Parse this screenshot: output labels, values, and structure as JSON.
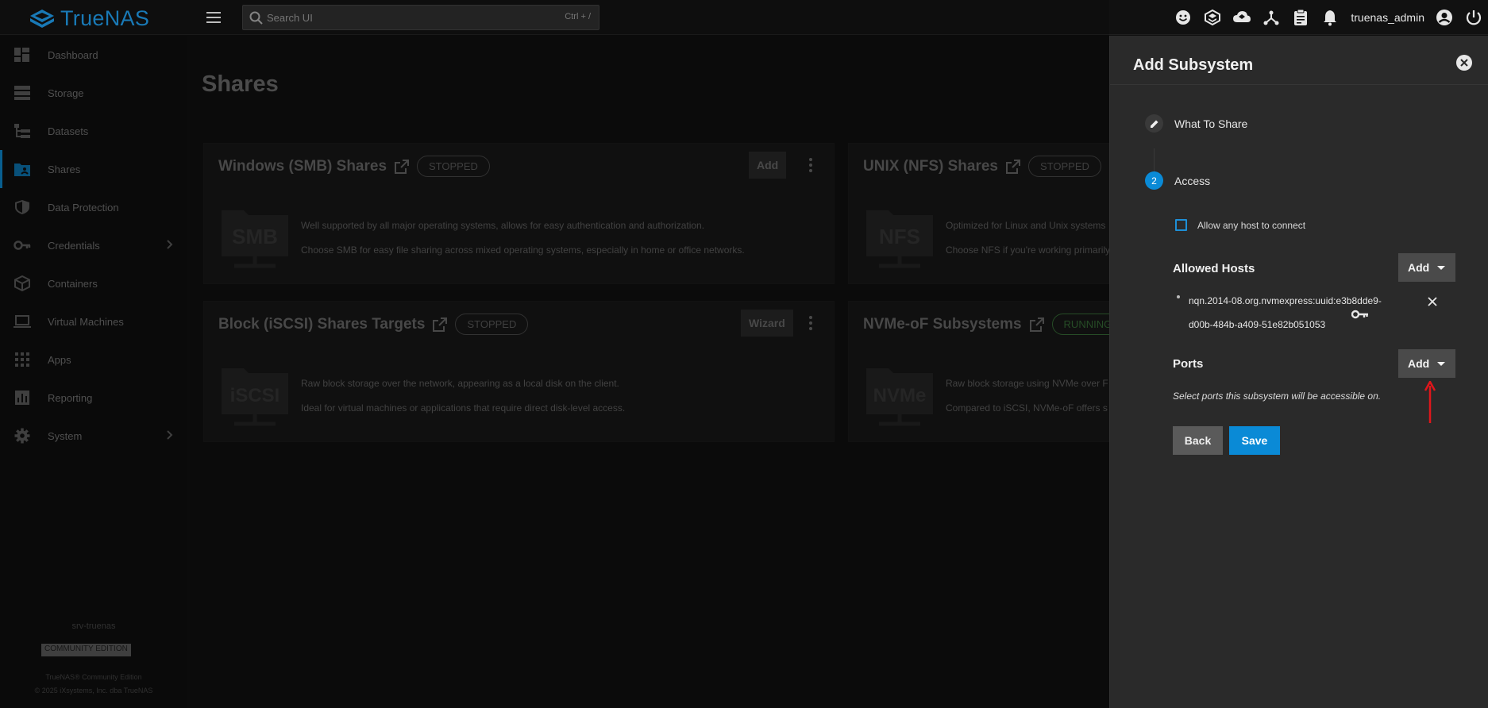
{
  "app": {
    "name": "TrueNAS",
    "search_placeholder": "Search UI",
    "search_shortcut": "Ctrl + /",
    "username": "truenas_admin"
  },
  "top_icons": [
    "smiley-icon",
    "truecommand-icon",
    "cloud-icon",
    "network-fork-icon",
    "clipboard-icon",
    "bell-icon",
    "account-circle-icon",
    "power-icon"
  ],
  "sidebar": {
    "items": [
      {
        "label": "Dashboard",
        "icon": "dashboard-icon"
      },
      {
        "label": "Storage",
        "icon": "storage-icon"
      },
      {
        "label": "Datasets",
        "icon": "datasets-icon"
      },
      {
        "label": "Shares",
        "icon": "shares-icon",
        "active": true
      },
      {
        "label": "Data Protection",
        "icon": "shield-icon"
      },
      {
        "label": "Credentials",
        "icon": "key-icon",
        "has_children": true
      },
      {
        "label": "Containers",
        "icon": "cube-icon"
      },
      {
        "label": "Virtual Machines",
        "icon": "laptop-icon"
      },
      {
        "label": "Apps",
        "icon": "apps-grid-icon"
      },
      {
        "label": "Reporting",
        "icon": "chart-icon"
      },
      {
        "label": "System",
        "icon": "gear-icon",
        "has_children": true
      }
    ],
    "hostname": "srv-truenas",
    "edition": "COMMUNITY EDITION",
    "copyright_line1": "TrueNAS® Community Edition",
    "copyright_line2": "© 2025 iXsystems, Inc. dba TrueNAS"
  },
  "main": {
    "page_title": "Shares",
    "cards": [
      {
        "title": "Windows (SMB) Shares",
        "status": "STOPPED",
        "button": "Add",
        "logo": "SMB",
        "desc": [
          "Well supported by all major operating systems, allows for easy authentication and authorization.",
          "Choose SMB for easy file sharing across mixed operating systems, especially in home or office networks."
        ]
      },
      {
        "title": "UNIX (NFS) Shares",
        "status": "STOPPED",
        "logo": "NFS",
        "desc": [
          "Optimized for Linux and Unix systems",
          "Choose NFS if you're working primarily"
        ]
      },
      {
        "title": "Block (iSCSI) Shares Targets",
        "status": "STOPPED",
        "button": "Wizard",
        "logo": "iSCSI",
        "desc": [
          "Raw block storage over the network, appearing as a local disk on the client.",
          "Ideal for virtual machines or applications that require direct disk-level access."
        ]
      },
      {
        "title": "NVMe-oF Subsystems",
        "status": "RUNNING",
        "logo": "NVMe",
        "desc": [
          "Raw block storage using NVMe over F",
          "Compared to iSCSI, NVMe-oF offers s"
        ]
      }
    ]
  },
  "panel": {
    "title": "Add Subsystem",
    "steps": [
      {
        "label": "What To Share",
        "marker": "edit-icon"
      },
      {
        "label": "Access",
        "marker": "2"
      }
    ],
    "allow_any_host_label": "Allow any host to connect",
    "allow_any_host_checked": false,
    "allowed_hosts_label": "Allowed Hosts",
    "add_label": "Add",
    "host_line1": "nqn.2014-08.org.nvmexpress:uuid:e3b8dde9-",
    "host_line2": "d00b-484b-a409-51e82b051053",
    "ports_label": "Ports",
    "ports_hint": "Select ports this subsystem will be accessible on.",
    "back_label": "Back",
    "save_label": "Save"
  },
  "colors": {
    "accent": "#0a8ad6",
    "brand": "#1e8fd6",
    "panel_bg": "#2a2a2a",
    "annotation_arrow": "#e0161b"
  }
}
